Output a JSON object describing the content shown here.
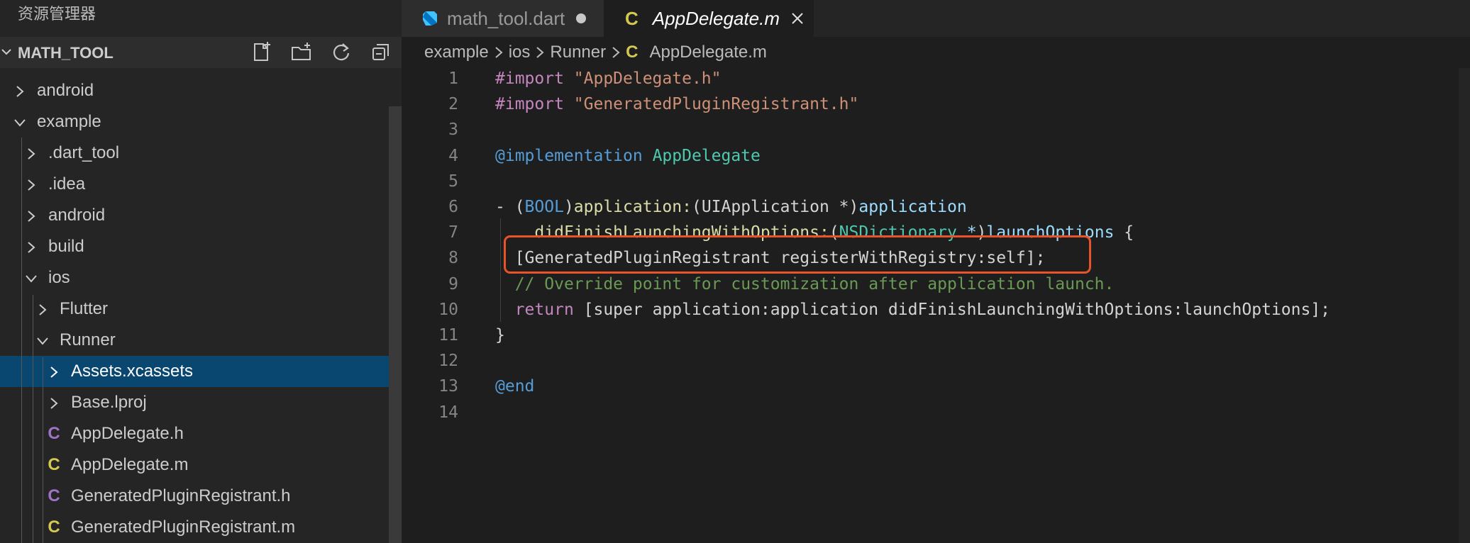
{
  "sidebar": {
    "title": "资源管理器",
    "project": "MATH_TOOL",
    "actions": [
      "new-file-icon",
      "new-folder-icon",
      "refresh-icon",
      "collapse-all-icon"
    ],
    "tree": [
      {
        "label": "android",
        "indent": 0,
        "type": "folder",
        "open": false
      },
      {
        "label": "example",
        "indent": 0,
        "type": "folder",
        "open": true
      },
      {
        "label": ".dart_tool",
        "indent": 1,
        "type": "folder",
        "open": false
      },
      {
        "label": ".idea",
        "indent": 1,
        "type": "folder",
        "open": false
      },
      {
        "label": "android",
        "indent": 1,
        "type": "folder",
        "open": false
      },
      {
        "label": "build",
        "indent": 1,
        "type": "folder",
        "open": false
      },
      {
        "label": "ios",
        "indent": 1,
        "type": "folder",
        "open": true
      },
      {
        "label": "Flutter",
        "indent": 2,
        "type": "folder",
        "open": false
      },
      {
        "label": "Runner",
        "indent": 2,
        "type": "folder",
        "open": true
      },
      {
        "label": "Assets.xcassets",
        "indent": 3,
        "type": "folder",
        "open": false,
        "selected": true
      },
      {
        "label": "Base.lproj",
        "indent": 3,
        "type": "folder",
        "open": false
      },
      {
        "label": "AppDelegate.h",
        "indent": 3,
        "type": "file",
        "icon": "C",
        "icon_color": "#a074c4"
      },
      {
        "label": "AppDelegate.m",
        "indent": 3,
        "type": "file",
        "icon": "C",
        "icon_color": "#d4c94e"
      },
      {
        "label": "GeneratedPluginRegistrant.h",
        "indent": 3,
        "type": "file",
        "icon": "C",
        "icon_color": "#a074c4"
      },
      {
        "label": "GeneratedPluginRegistrant.m",
        "indent": 3,
        "type": "file",
        "icon": "C",
        "icon_color": "#d4c94e"
      }
    ]
  },
  "tabs": [
    {
      "label": "math_tool.dart",
      "icon": "dart-icon",
      "dirty": true
    },
    {
      "label": "AppDelegate.m",
      "icon": "C",
      "active": true
    }
  ],
  "breadcrumb": [
    "example",
    "ios",
    "Runner",
    "AppDelegate.m"
  ],
  "breadcrumb_file_icon": "C",
  "editor": {
    "line_numbers": [
      "1",
      "2",
      "3",
      "4",
      "5",
      "6",
      "7",
      "8",
      "9",
      "10",
      "11",
      "12",
      "13",
      "14"
    ],
    "lines": [
      [
        [
          "k-pink",
          "#import "
        ],
        [
          "k-str",
          "\"AppDelegate.h\""
        ]
      ],
      [
        [
          "k-pink",
          "#import "
        ],
        [
          "k-str",
          "\"GeneratedPluginRegistrant.h\""
        ]
      ],
      [],
      [
        [
          "k-blue",
          "@implementation "
        ],
        [
          "k-teal",
          "AppDelegate"
        ]
      ],
      [],
      [
        [
          "",
          "- ("
        ],
        [
          "k-blue",
          "BOOL"
        ],
        [
          "",
          ")"
        ],
        [
          "k-fn",
          "application:"
        ],
        [
          "",
          "(UIApplication *)"
        ],
        [
          "k-var",
          "application"
        ]
      ],
      [
        [
          "",
          "    "
        ],
        [
          "k-fn",
          "didFinishLaunchingWithOptions:"
        ],
        [
          "",
          "("
        ],
        [
          "k-teal",
          "NSDictionary"
        ],
        [
          "k-var",
          " *"
        ],
        [
          "",
          ")"
        ],
        [
          "k-var",
          "launchOptions"
        ],
        [
          "",
          " {"
        ]
      ],
      [
        [
          "",
          "  [GeneratedPluginRegistrant registerWithRegistry:self];"
        ]
      ],
      [
        [
          "",
          "  "
        ],
        [
          "k-com",
          "// Override point for customization after application launch."
        ]
      ],
      [
        [
          "",
          "  "
        ],
        [
          "k-pink",
          "return"
        ],
        [
          "",
          " [super application:application didFinishLaunchingWithOptions:launchOptions];"
        ]
      ],
      [
        [
          "",
          "}"
        ]
      ],
      [],
      [
        [
          "k-blue",
          "@end"
        ]
      ],
      []
    ]
  },
  "colors": {
    "highlight_box": "#e8542a",
    "selection": "#094771"
  }
}
